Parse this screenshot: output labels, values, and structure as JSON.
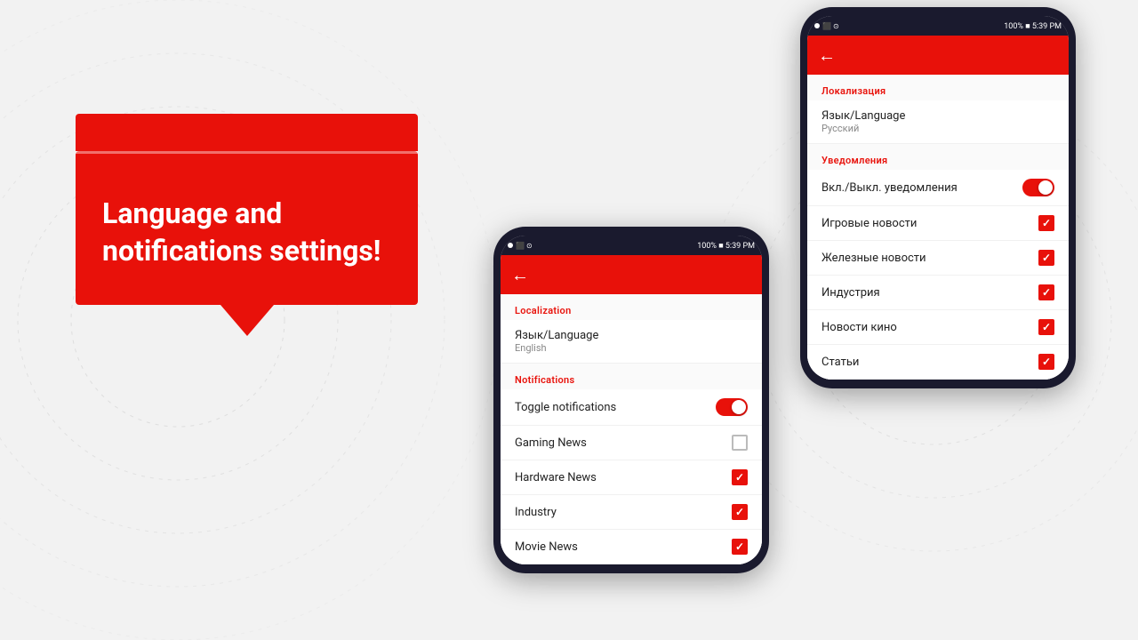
{
  "background": {
    "color": "#f0f0f0"
  },
  "speechBubble": {
    "text": "Language and notifications settings!"
  },
  "phone1": {
    "statusBar": {
      "left": "● ⬛ ⊙",
      "right": "100% ■ 5:39 PM"
    },
    "sections": [
      {
        "label": "Localization",
        "items": [
          {
            "title": "Язык/Language",
            "sub": "English",
            "control": "none"
          }
        ]
      },
      {
        "label": "Notifications",
        "items": [
          {
            "title": "Toggle notifications",
            "control": "toggle-on"
          },
          {
            "title": "Gaming News",
            "control": "checkbox-off"
          },
          {
            "title": "Hardware News",
            "control": "checkbox-on"
          },
          {
            "title": "Industry",
            "control": "checkbox-on"
          },
          {
            "title": "Movie News",
            "control": "checkbox-on"
          }
        ]
      }
    ]
  },
  "phone2": {
    "statusBar": {
      "left": "● ⬛ ⊙",
      "right": "100% ■ 5:39 PM"
    },
    "sections": [
      {
        "label": "Локализация",
        "items": [
          {
            "title": "Язык/Language",
            "sub": "Русский",
            "control": "none"
          }
        ]
      },
      {
        "label": "Уведомления",
        "items": [
          {
            "title": "Вкл./Выкл. уведомления",
            "control": "toggle-on"
          },
          {
            "title": "Игровые новости",
            "control": "checkbox-on"
          },
          {
            "title": "Железные новости",
            "control": "checkbox-on"
          },
          {
            "title": "Индустрия",
            "control": "checkbox-on"
          },
          {
            "title": "Новости кино",
            "control": "checkbox-on"
          },
          {
            "title": "Статьи",
            "control": "checkbox-on"
          }
        ]
      }
    ]
  }
}
